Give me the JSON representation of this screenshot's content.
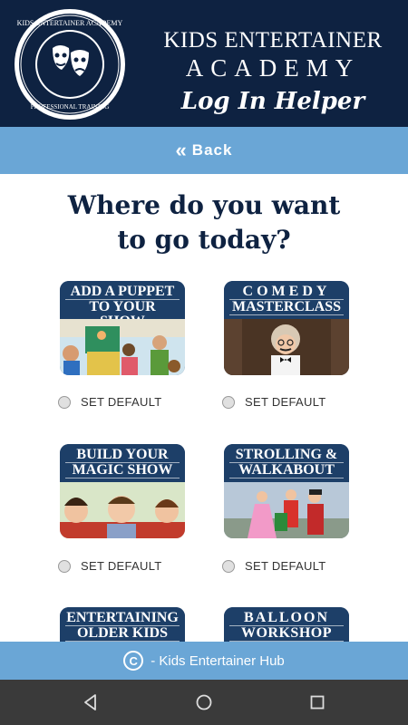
{
  "header": {
    "logo_text": "KIDS ENTERTAINER ACADEMY · PROFESSIONAL TRAINING",
    "line1": "KIDS ENTERTAINER",
    "line2": "ACADEMY",
    "line3": "Log In Helper"
  },
  "back": {
    "label": "Back",
    "icon": "double-chevron-left-icon"
  },
  "heading": {
    "line1": "Where do you want",
    "line2": "to go today?"
  },
  "tiles": [
    {
      "line1": "ADD A PUPPET",
      "line2": "TO YOUR SHOW",
      "radio_label": "SET DEFAULT"
    },
    {
      "line1": "COMEDY",
      "line2": "MASTERCLASS",
      "radio_label": "SET DEFAULT"
    },
    {
      "line1": "BUILD YOUR",
      "line2": "MAGIC SHOW",
      "radio_label": "SET DEFAULT"
    },
    {
      "line1": "STROLLING &",
      "line2": "WALKABOUT",
      "radio_label": "SET DEFAULT"
    },
    {
      "line1": "ENTERTAINING",
      "line2": "OLDER KIDS"
    },
    {
      "line1": "BALLOON",
      "line2": "WORKSHOP"
    }
  ],
  "footer": {
    "text": "- Kids Entertainer Hub",
    "icon": "copyright-icon"
  },
  "navbar": {
    "back_icon": "nav-back-icon",
    "home_icon": "nav-home-icon",
    "recents_icon": "nav-recents-icon"
  },
  "colors": {
    "navy": "#0e2241",
    "accent_blue": "#6aa6d6",
    "tile_blue": "#1d3f68"
  }
}
